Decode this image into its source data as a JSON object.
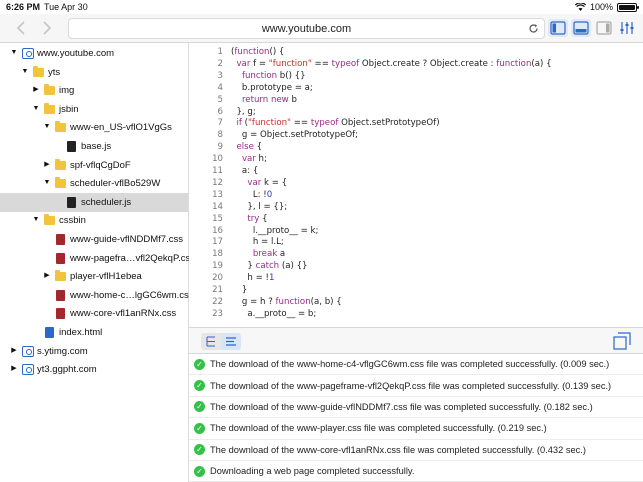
{
  "status_bar": {
    "time": "6:26 PM",
    "date": "Tue Apr 30",
    "battery": "100%",
    "battery_level": 1.0
  },
  "toolbar": {
    "back_icon": "chevron-left-icon",
    "forward_icon": "chevron-right-icon",
    "url": "www.youtube.com",
    "reload_icon": "reload-icon"
  },
  "sidebar": {
    "tree": [
      {
        "label": "www.youtube.com",
        "icon": "globe",
        "expanded": true,
        "depth": 0
      },
      {
        "label": "yts",
        "icon": "folder",
        "expanded": true,
        "depth": 1
      },
      {
        "label": "img",
        "icon": "folder",
        "expanded": false,
        "depth": 2
      },
      {
        "label": "jsbin",
        "icon": "folder",
        "expanded": true,
        "depth": 2
      },
      {
        "label": "www-en_US-vflO1VgGs",
        "icon": "folder",
        "expanded": true,
        "depth": 3
      },
      {
        "label": "base.js",
        "icon": "js",
        "depth": 4
      },
      {
        "label": "spf-vflqCgDoF",
        "icon": "folder",
        "expanded": false,
        "depth": 3
      },
      {
        "label": "scheduler-vflBo529W",
        "icon": "folder",
        "expanded": true,
        "depth": 3
      },
      {
        "label": "scheduler.js",
        "icon": "js",
        "depth": 4,
        "selected": true
      },
      {
        "label": "cssbin",
        "icon": "folder",
        "expanded": true,
        "depth": 2
      },
      {
        "label": "www-guide-vflNDDMf7.css",
        "icon": "css",
        "depth": 3
      },
      {
        "label": "www-pagefra…vfl2QekqP.css",
        "icon": "css",
        "depth": 3
      },
      {
        "label": "player-vflH1ebea",
        "icon": "folder",
        "expanded": false,
        "depth": 3
      },
      {
        "label": "www-home-c…lgGC6wm.css",
        "icon": "css",
        "depth": 3
      },
      {
        "label": "www-core-vfl1anRNx.css",
        "icon": "css",
        "depth": 3
      },
      {
        "label": "index.html",
        "icon": "html",
        "depth": 2
      },
      {
        "label": "s.ytimg.com",
        "icon": "globe",
        "expanded": false,
        "depth": 0
      },
      {
        "label": "yt3.ggpht.com",
        "icon": "globe",
        "expanded": false,
        "depth": 0
      }
    ]
  },
  "code": {
    "lines": [
      "(function() {",
      "  var f = \"function\" == typeof Object.create ? Object.create : function(a) {",
      "    function b() {}",
      "    b.prototype = a;",
      "    return new b",
      "  }, g;",
      "  if (\"function\" == typeof Object.setPrototypeOf)",
      "    g = Object.setPrototypeOf;",
      "  else {",
      "    var h;",
      "    a: {",
      "      var k = {",
      "        L: !0",
      "      }, l = {};",
      "      try {",
      "        l.__proto__ = k;",
      "        h = l.L;",
      "        break a",
      "      } catch (a) {}",
      "      h = !1",
      "    }",
      "    g = h ? function(a, b) {",
      "      a.__proto__ = b;"
    ]
  },
  "log": {
    "entries": [
      "The download of the www-home-c4-vflgGC6wm.css file was completed successfully. (0.009 sec.)",
      "The download of the www-pageframe-vfl2QekqP.css file was completed successfully. (0.139 sec.)",
      "The download of the www-guide-vflNDDMf7.css file was completed successfully. (0.182 sec.)",
      "The download of the www-player.css file was completed successfully. (0.219 sec.)",
      "The download of the www-core-vfl1anRNx.css file was completed successfully. (0.432 sec.)",
      "Downloading a web page completed successfully."
    ]
  },
  "colors": {
    "accent": "#2c67c9",
    "success": "#35c04a",
    "folder": "#f2c33c",
    "keyword": "#9a2b86",
    "string": "#c6302b"
  }
}
